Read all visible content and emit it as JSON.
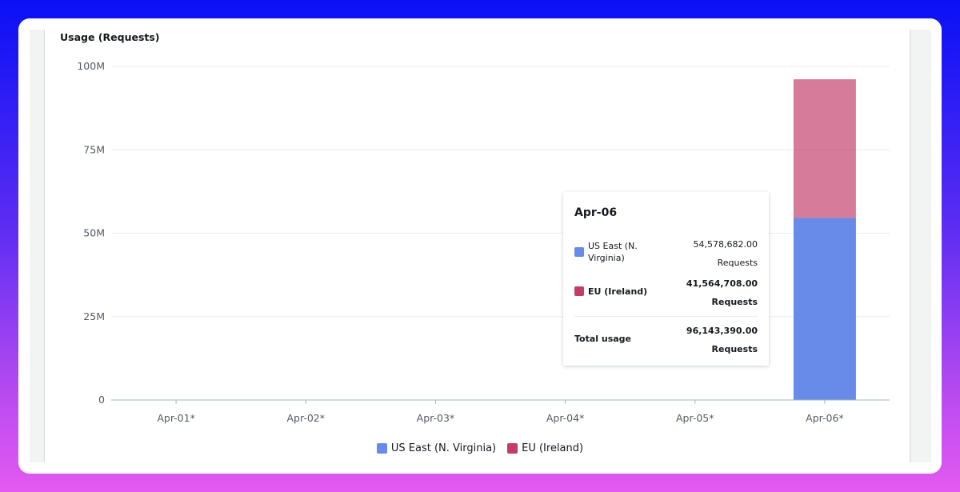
{
  "panel": {
    "title": "Usage (Requests)"
  },
  "chart_data": {
    "type": "bar",
    "stacked": true,
    "title": "Usage (Requests)",
    "categories": [
      "Apr-01*",
      "Apr-02*",
      "Apr-03*",
      "Apr-04*",
      "Apr-05*",
      "Apr-06*"
    ],
    "series": [
      {
        "name": "US East (N. Virginia)",
        "color": "#688ae8",
        "values": [
          0,
          0,
          0,
          0,
          0,
          54578682
        ]
      },
      {
        "name": "EU (Ireland)",
        "color": "#c33d69",
        "values": [
          0,
          0,
          0,
          0,
          0,
          41564708
        ]
      }
    ],
    "ylim": [
      0,
      100000000
    ],
    "yticks": [
      0,
      25000000,
      50000000,
      75000000,
      100000000
    ],
    "ytick_labels": [
      "0",
      "25M",
      "50M",
      "75M",
      "100M"
    ],
    "grid": true,
    "legend_position": "bottom-center",
    "highlighted_category": "Apr-06*"
  },
  "tooltip": {
    "title": "Apr-06",
    "rows": [
      {
        "label": "US East (N. Virginia)",
        "value": "54,578,682.00",
        "unit": "Requests",
        "color": "#688ae8"
      },
      {
        "label": "EU (Ireland)",
        "value": "41,564,708.00",
        "unit": "Requests",
        "color": "#c33d69"
      }
    ],
    "total": {
      "label": "Total usage",
      "value": "96,143,390.00",
      "unit": "Requests"
    }
  }
}
